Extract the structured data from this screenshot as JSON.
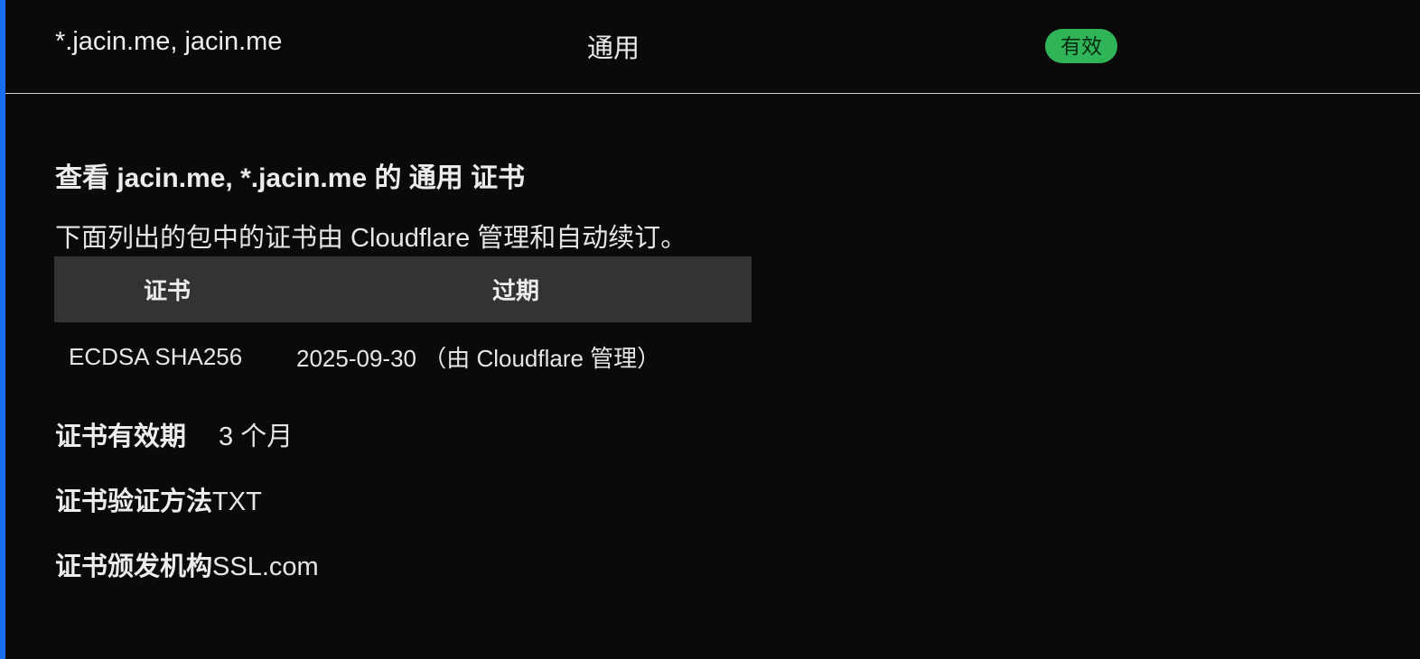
{
  "summary_row": {
    "hostnames": "*.jacin.me, jacin.me",
    "type": "通用",
    "status": "有效",
    "status_color": "#2fb457"
  },
  "detail": {
    "title": "查看 jacin.me, *.jacin.me 的 通用 证书",
    "description": "下面列出的包中的证书由 Cloudflare 管理和自动续订。",
    "table": {
      "headers": [
        "证书",
        "过期"
      ],
      "rows": [
        [
          "ECDSA SHA256",
          "2025-09-30 （由 Cloudflare 管理）"
        ]
      ]
    },
    "validity_label": "证书有效期",
    "validity_value": "3 个月",
    "validation_method_label": "证书验证方法",
    "validation_method_value": "TXT",
    "issuer_label": "证书颁发机构",
    "issuer_value": "SSL.com"
  },
  "colors": {
    "accent_bar": "#1a6ef5",
    "background": "#0a0a0a",
    "table_header_bg": "#333333"
  }
}
